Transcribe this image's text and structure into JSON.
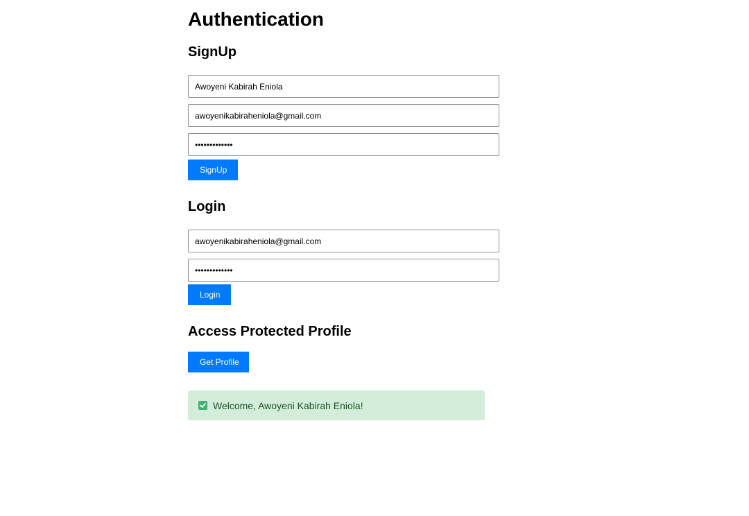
{
  "page": {
    "title": "Authentication"
  },
  "signup": {
    "heading": "SignUp",
    "name_value": "Awoyeni Kabirah Eniola",
    "email_value": "awoyenikabiraheniola@gmail.com",
    "password_value": "•••••••••••••",
    "button_label": "SignUp"
  },
  "login": {
    "heading": "Login",
    "email_value": "awoyenikabiraheniola@gmail.com",
    "password_value": "•••••••••••••",
    "button_label": "Login"
  },
  "profile": {
    "heading": "Access Protected Profile",
    "button_label": "Get Profile",
    "message": "Welcome, Awoyeni Kabirah Eniola!",
    "message_icon": "check-mark-icon"
  },
  "colors": {
    "primary_button": "#007bff",
    "success_bg": "#d4edda",
    "success_text": "#155724",
    "check_icon": "#3cb371"
  }
}
